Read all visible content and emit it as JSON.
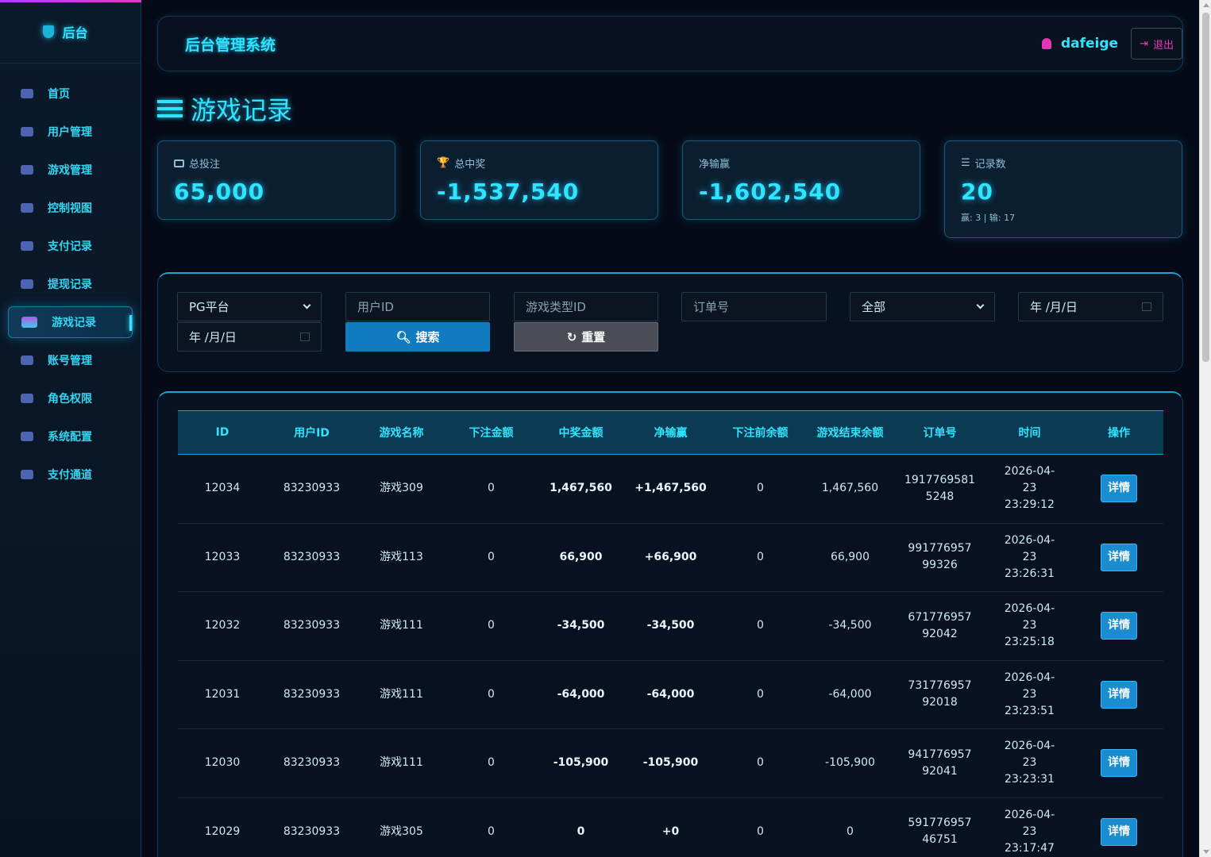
{
  "sidebar": {
    "brand": "后台",
    "items": [
      {
        "label": "首页"
      },
      {
        "label": "用户管理"
      },
      {
        "label": "游戏管理"
      },
      {
        "label": "控制视图"
      },
      {
        "label": "支付记录"
      },
      {
        "label": "提现记录"
      },
      {
        "label": "游戏记录"
      },
      {
        "label": "账号管理"
      },
      {
        "label": "角色权限"
      },
      {
        "label": "系统配置"
      },
      {
        "label": "支付通道"
      }
    ]
  },
  "header": {
    "title": "后台管理系统",
    "username": "dafeige",
    "logout_label": "退出"
  },
  "page": {
    "title": "游戏记录"
  },
  "stats": {
    "total_bet": {
      "label": "总投注",
      "value": "65,000"
    },
    "total_win": {
      "label": "总中奖",
      "value": "-1,537,540"
    },
    "net": {
      "label": "净输赢",
      "value": "-1,602,540"
    },
    "records": {
      "label": "记录数",
      "value": "20",
      "sub": "赢: 3 | 输: 17"
    }
  },
  "filters": {
    "platform": "PG平台",
    "user_id_placeholder": "用户ID",
    "game_type_placeholder": "游戏类型ID",
    "order_placeholder": "订单号",
    "status": "全部",
    "date_start": "年 /月/日",
    "date_end": "年 /月/日",
    "search_label": "搜索",
    "reset_label": "重置"
  },
  "table": {
    "headers": [
      "ID",
      "用户ID",
      "游戏名称",
      "下注金额",
      "中奖金额",
      "净输赢",
      "下注前余额",
      "游戏结束余额",
      "订单号",
      "时间",
      "操作"
    ],
    "rows": [
      {
        "id": "12034",
        "uid": "83230933",
        "game": "游戏309",
        "bet": "0",
        "win": "1,467,560",
        "net": "+1,467,560",
        "before": "0",
        "after": "1,467,560",
        "order1": "1917769581",
        "order2": "5248",
        "t1": "2026-04-",
        "t2": "23",
        "t3": "23:29:12",
        "action": "详情"
      },
      {
        "id": "12033",
        "uid": "83230933",
        "game": "游戏113",
        "bet": "0",
        "win": "66,900",
        "net": "+66,900",
        "before": "0",
        "after": "66,900",
        "order1": "991776957",
        "order2": "99326",
        "t1": "2026-04-",
        "t2": "23",
        "t3": "23:26:31",
        "action": "详情"
      },
      {
        "id": "12032",
        "uid": "83230933",
        "game": "游戏111",
        "bet": "0",
        "win": "-34,500",
        "net": "-34,500",
        "before": "0",
        "after": "-34,500",
        "order1": "671776957",
        "order2": "92042",
        "t1": "2026-04-",
        "t2": "23",
        "t3": "23:25:18",
        "action": "详情"
      },
      {
        "id": "12031",
        "uid": "83230933",
        "game": "游戏111",
        "bet": "0",
        "win": "-64,000",
        "net": "-64,000",
        "before": "0",
        "after": "-64,000",
        "order1": "731776957",
        "order2": "92018",
        "t1": "2026-04-",
        "t2": "23",
        "t3": "23:23:51",
        "action": "详情"
      },
      {
        "id": "12030",
        "uid": "83230933",
        "game": "游戏111",
        "bet": "0",
        "win": "-105,900",
        "net": "-105,900",
        "before": "0",
        "after": "-105,900",
        "order1": "941776957",
        "order2": "92041",
        "t1": "2026-04-",
        "t2": "23",
        "t3": "23:23:31",
        "action": "详情"
      },
      {
        "id": "12029",
        "uid": "83230933",
        "game": "游戏305",
        "bet": "0",
        "win": "0",
        "net": "+0",
        "before": "0",
        "after": "0",
        "order1": "591776957",
        "order2": "46751",
        "t1": "2026-04-",
        "t2": "23",
        "t3": "23:17:47",
        "action": "详情"
      }
    ]
  }
}
